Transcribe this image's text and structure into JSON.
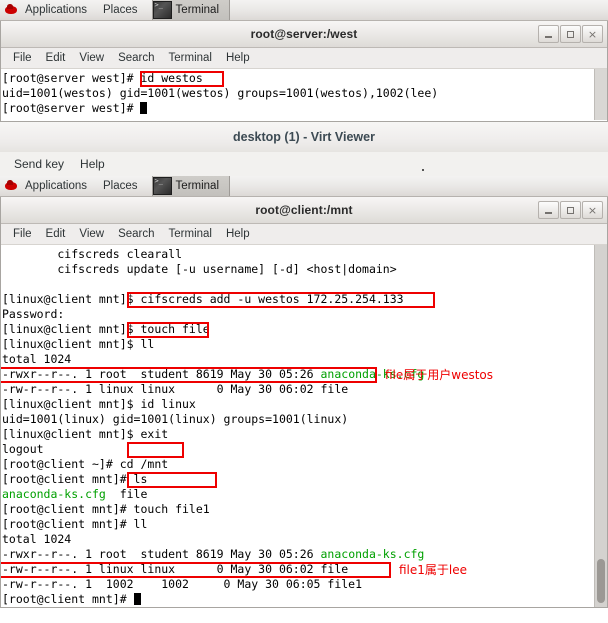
{
  "panel_top": {
    "logo": "redhat-logo",
    "applications": "Applications",
    "places": "Places",
    "window_button": "Terminal"
  },
  "server_terminal": {
    "title": "root@server:/west",
    "menu": [
      "File",
      "Edit",
      "View",
      "Search",
      "Terminal",
      "Help"
    ],
    "buttons": {
      "minimize": "_",
      "maximize": "□",
      "close": "×"
    },
    "lines": [
      {
        "text": "[root@server west]# id westos"
      },
      {
        "text": "uid=1001(westos) gid=1001(westos) groups=1001(westos),1002(lee)"
      },
      {
        "text": "[root@server west]# "
      }
    ]
  },
  "virt_viewer": {
    "title": "desktop (1) - Virt Viewer",
    "menu": [
      "Send key",
      "Help"
    ]
  },
  "panel_guest": {
    "logo": "redhat-logo",
    "applications": "Applications",
    "places": "Places",
    "window_button": "Terminal"
  },
  "client_terminal": {
    "title": "root@client:/mnt",
    "menu": [
      "File",
      "Edit",
      "View",
      "Search",
      "Terminal",
      "Help"
    ],
    "buttons": {
      "minimize": "_",
      "maximize": "□",
      "close": "×"
    },
    "lines": [
      {
        "text": "        cifscreds clearall"
      },
      {
        "text": "        cifscreds update [-u username] [-d] <host|domain>"
      },
      {
        "text": ""
      },
      {
        "text": "[linux@client mnt]$ cifscreds add -u westos 172.25.254.133"
      },
      {
        "text": "Password:"
      },
      {
        "text": "[linux@client mnt]$ touch file"
      },
      {
        "text": "[linux@client mnt]$ ll"
      },
      {
        "text": "total 1024"
      },
      {
        "text": "-rwxr--r--. 1 root  student 8619 May 30 05:26 ",
        "green": "anaconda-ks.cfg"
      },
      {
        "text": "-rw-r--r--. 1 linux linux      0 May 30 06:02 file"
      },
      {
        "text": "[linux@client mnt]$ id linux"
      },
      {
        "text": "uid=1001(linux) gid=1001(linux) groups=1001(linux)"
      },
      {
        "text": "[linux@client mnt]$ exit"
      },
      {
        "text": "logout"
      },
      {
        "text": "[root@client ~]# cd /mnt"
      },
      {
        "text": "[root@client mnt]# ls"
      },
      {
        "text": "",
        "green": "anaconda-ks.cfg",
        "after_green": "  file"
      },
      {
        "text": "[root@client mnt]# touch file1"
      },
      {
        "text": "[root@client mnt]# ll"
      },
      {
        "text": "total 1024"
      },
      {
        "text": "-rwxr--r--. 1 root  student 8619 May 30 05:26 ",
        "green": "anaconda-ks.cfg"
      },
      {
        "text": "-rw-r--r--. 1 linux linux      0 May 30 06:02 file"
      },
      {
        "text": "-rw-r--r--. 1  1002    1002     0 May 30 06:05 file1"
      },
      {
        "text": "[root@client mnt]# "
      }
    ]
  },
  "annotations": {
    "file_owner_note": "file属于用户westos",
    "file1_owner_note": "file1属于lee"
  },
  "highlights": {
    "id_westos": "id westos",
    "cifscreds_add": "cifscreds add -u westos 172.25.254.133",
    "touch_file": "touch file",
    "file_ll_row": "-rw-r--r--. 1 linux linux      0 May 30 06:02 file",
    "cd_mnt": "cd /mnt",
    "touch_file1": "touch file1",
    "file1_ll_row": "-rw-r--r--. 1  1002    1002     0 May 30 06:05 file1"
  },
  "colors": {
    "highlight_red": "#ee0000",
    "terminal_green": "#00a000",
    "panel_bg": "#e9e7e5"
  }
}
